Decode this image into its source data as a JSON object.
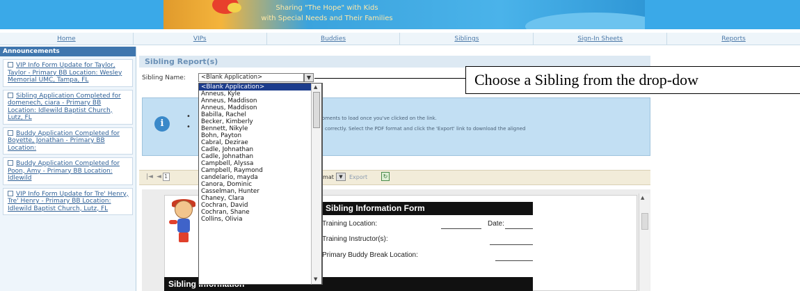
{
  "banner": {
    "line1": "Sharing \"The Hope\" with Kids",
    "line2": "with Special Needs and Their Families"
  },
  "nav": {
    "items": [
      "Home",
      "VIPs",
      "Buddies",
      "Siblings",
      "Sign-In Sheets",
      "Reports"
    ]
  },
  "sidebar": {
    "title": "Announcements",
    "items": [
      {
        "text": "VIP Info Form Update for Taylor, Taylor - Primary BB Location: Wesley Memorial UMC, Tampa, FL"
      },
      {
        "text": "Sibling Application Completed for domenech, ciara - Primary BB Location: Idlewild Baptist Church, Lutz, FL"
      },
      {
        "text": "Buddy Application Completed for Boyette, Jonathan - Primary BB Location:"
      },
      {
        "text": "Buddy Application Completed for Poon, Amy - Primary BB Location: Idlewild"
      },
      {
        "text": "VIP Info Form Update for Tre' Henry, Tre' Henry - Primary BB Location: Idlewild Baptist Church, Lutz, FL"
      }
    ]
  },
  "main": {
    "title": "Sibling Report(s)",
    "sibling_name_label": "Sibling Name:",
    "selected_value": "<Blank Application>",
    "info_line1": "moments to load once you've clicked on the link.",
    "info_line2": "ed correctly. Select the PDF format and click the 'Export' link to download the aligned",
    "page_number": "1",
    "format_label": "ormat",
    "export_label": "Export"
  },
  "dropdown": {
    "options": [
      "<Blank Application>",
      "Anneus, Kyle",
      "Anneus, Maddison",
      "Anneus, Maddison",
      "Babilla, Rachel",
      "Becker, Kimberly",
      "Bennett, Nikyle",
      "Bohn, Payton",
      "Cabral, Dezirae",
      "Cadle, Johnathan",
      "Cadle, Johnathan",
      "Campbell, Alyssa",
      "Campbell, Raymond",
      "candelario, mayda",
      "Canora, Dominic",
      "Casselman, Hunter",
      "Chaney, Clara",
      "Cochran, David",
      "Cochran, Shane",
      "Collins, Olivia"
    ]
  },
  "report": {
    "form_title": "Sibling Information Form",
    "training_location_label": "Training Location:",
    "date_label": "Date:",
    "training_instructor_label": "Training Instructor(s):",
    "primary_location_label": "Primary Buddy Break Location:",
    "section_title": "Sibling Information"
  },
  "callout": {
    "text": "Choose a Sibling from the drop-dow"
  },
  "colors": {
    "accent": "#3f76ae",
    "selection": "#1c3c8c",
    "info_panel": "#c2dff3",
    "toolbar": "#f2ecd9"
  }
}
